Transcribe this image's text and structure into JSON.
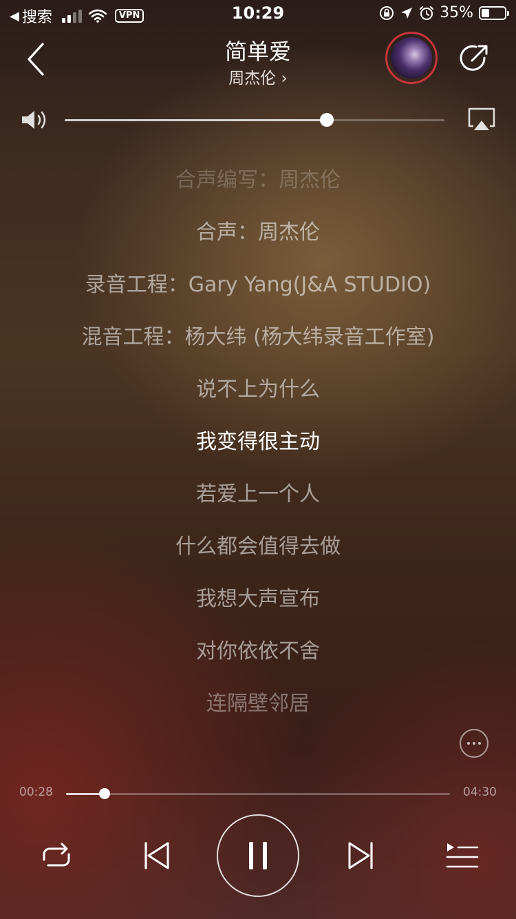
{
  "status_bar": {
    "back_app": "搜索",
    "vpn": "VPN",
    "time": "10:29",
    "battery": "35%"
  },
  "header": {
    "song_title": "简单爱",
    "artist": "周杰伦",
    "artist_chevron": "›",
    "accent_color": "#c8353a"
  },
  "volume": {
    "level": 0.69
  },
  "lyrics": {
    "lines": [
      "合声编写：周杰伦",
      "合声：周杰伦",
      "录音工程：Gary Yang(J&A STUDIO)",
      "混音工程：杨大纬 (杨大纬录音工作室)",
      "说不上为什么",
      "我变得很主动",
      "若爱上一个人",
      "什么都会值得去做",
      "我想大声宣布",
      "对你依依不舍",
      "连隔壁邻居"
    ],
    "current_index": 5
  },
  "player": {
    "current_time": "00:28",
    "total_time": "04:30",
    "progress": 0.1,
    "state": "playing"
  },
  "icons": {
    "back": "chevron-left-icon",
    "share": "share-icon",
    "volume": "speaker-icon",
    "airplay": "airplay-icon",
    "more": "more-icon",
    "repeat": "repeat-icon",
    "prev": "previous-icon",
    "pause": "pause-icon",
    "next": "next-icon",
    "playlist": "playlist-icon"
  }
}
